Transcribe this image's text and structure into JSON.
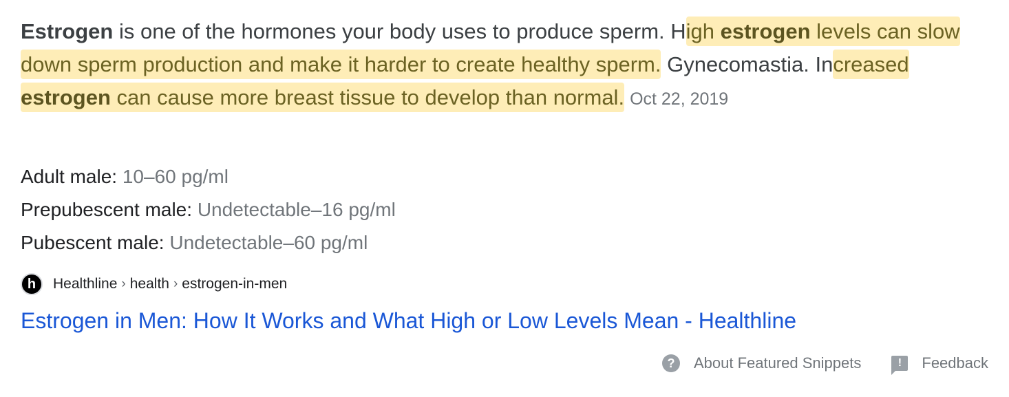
{
  "snippet": {
    "s1_bold": "Estrogen",
    "s1_rest": " is one of the hormones your body uses to produce sperm. H",
    "s2_hl_a": "igh ",
    "s2_hl_bold": "estrogen",
    "s2_hl_b": " levels can slow down sperm production and make it harder to create healthy sperm.",
    "s3_plain": " Gynecomastia. In",
    "s3_hl_a": "creased ",
    "s3_hl_bold": "estrogen",
    "s3_hl_b": " can cause more breast tissue to develop than normal.",
    "date": "Oct 22, 2019"
  },
  "facts": [
    {
      "key": "Adult male:",
      "value": "10–60 pg/ml"
    },
    {
      "key": "Prepubescent male:",
      "value": "Undetectable–16 pg/ml"
    },
    {
      "key": "Pubescent male:",
      "value": "Undetectable–60 pg/ml"
    }
  ],
  "source": {
    "favicon_letter": "h",
    "site": "Healthline",
    "crumbs": [
      "health",
      "estrogen-in-men"
    ],
    "separator": "›"
  },
  "result_title": "Estrogen in Men: How It Works and What High or Low Levels Mean - Healthline",
  "footer": {
    "about_label": "About Featured Snippets",
    "feedback_label": "Feedback",
    "about_icon": "?",
    "feedback_icon": "!"
  },
  "colors": {
    "highlight": "#fdd65f",
    "link": "#1a57d6",
    "muted": "#70757a"
  }
}
